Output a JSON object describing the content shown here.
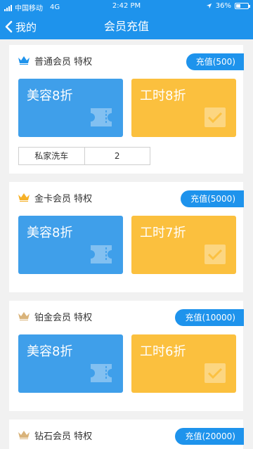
{
  "status_bar": {
    "carrier": "中国移动",
    "network": "4G",
    "time": "2:42 PM",
    "battery": "36%",
    "battery_level": 0.36
  },
  "nav": {
    "back_label": "我的",
    "title": "会员充值"
  },
  "cards": [
    {
      "title": "普通会员 特权",
      "recharge": "充值(500)",
      "crown_color": "#1e93ec",
      "beauty": "美容8折",
      "labor": "工时8折",
      "bonus": {
        "item": "私家洗车",
        "count": "2"
      }
    },
    {
      "title": "金卡会员 特权",
      "recharge": "充值(5000)",
      "crown_color": "#f6b128",
      "beauty": "美容8折",
      "labor": "工时7折"
    },
    {
      "title": "铂金会员 特权",
      "recharge": "充值(10000)",
      "crown_color": "#d9b37a",
      "beauty": "美容8折",
      "labor": "工时6折"
    },
    {
      "title": "钻石会员 特权",
      "recharge": "充值(20000)",
      "crown_color": "#d9b37a"
    }
  ],
  "colors": {
    "brand_blue": "#1e93ec",
    "tile_blue": "#3f9fea",
    "tile_gold": "#fbc03e"
  }
}
